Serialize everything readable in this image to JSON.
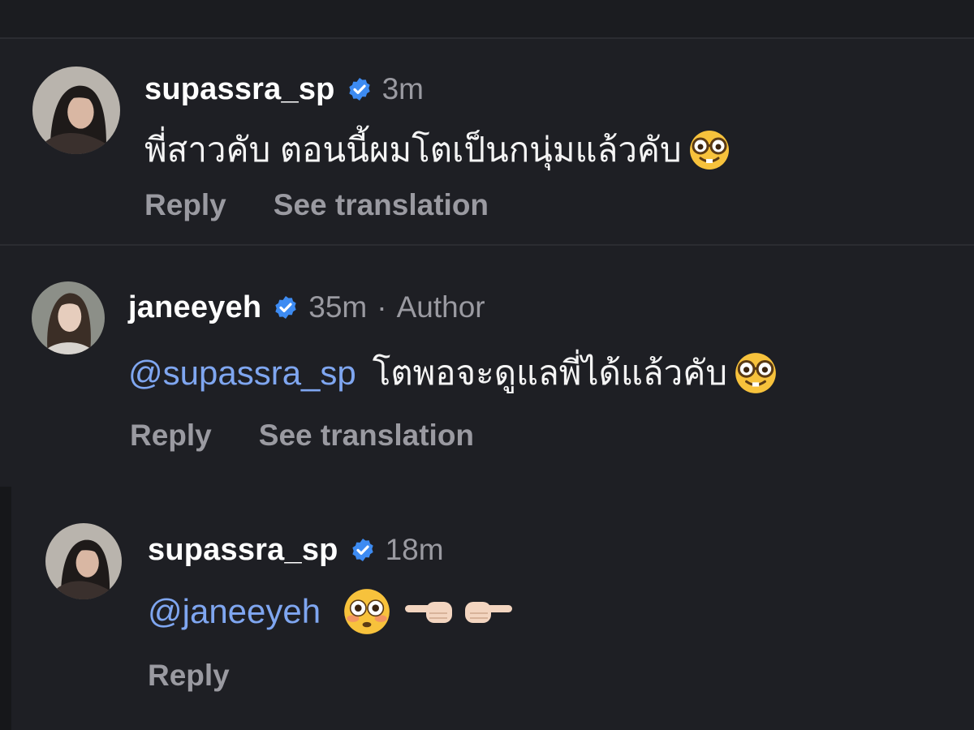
{
  "comments": [
    {
      "username": "supassra_sp",
      "verified": true,
      "time": "3m",
      "mention": "",
      "text": "พี่สาวคับ ตอนนี้ผมโตเป็นกนุ่มแล้วคับ",
      "emoji": [
        "nerd-face-emoji"
      ],
      "actions": {
        "reply": "Reply",
        "translate": "See translation"
      }
    },
    {
      "username": "janeeyeh",
      "verified": true,
      "time": "35m",
      "separator": "·",
      "role": "Author",
      "mention": "@supassra_sp",
      "text": "โตพอจะดูแลพี่ได้แล้วคับ",
      "emoji": [
        "nerd-face-emoji"
      ],
      "actions": {
        "reply": "Reply",
        "translate": "See translation"
      }
    },
    {
      "username": "supassra_sp",
      "verified": true,
      "time": "18m",
      "mention": "@janeeyeh",
      "text": "",
      "emoji": [
        "flushed-face-emoji",
        "pointing-left-hand-emoji",
        "pointing-right-hand-emoji"
      ],
      "actions": {
        "reply": "Reply"
      }
    }
  ],
  "colors": {
    "background": "#1e1f24",
    "mention": "#7fa6f0",
    "verified_badge": "#3d8bf2",
    "muted_text": "#9a9aa1"
  }
}
